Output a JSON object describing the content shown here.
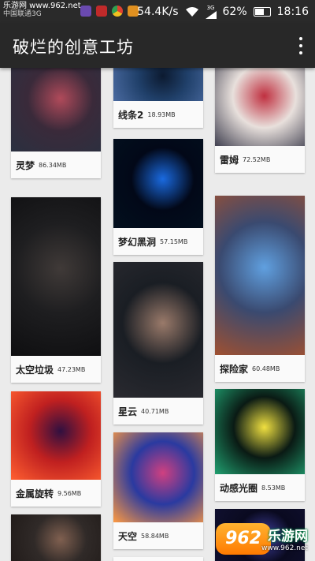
{
  "status_bar": {
    "watermark": "乐游网 www.962.net",
    "carrier": "中国联通3G",
    "speed": "54.4K/s",
    "network": "3G",
    "battery": "62%",
    "battery_level": 0.62,
    "time": "18:16"
  },
  "app_bar": {
    "title": "破烂的创意工坊"
  },
  "wallpapers": [
    {
      "name": "灵梦",
      "size": "86.34MB",
      "colors": [
        "#3a2a3a",
        "#b04a5a",
        "#2a3040"
      ]
    },
    {
      "name": "线条2",
      "size": "18.93MB",
      "colors": [
        "#20406a",
        "#0c1a30",
        "#4a6aa0"
      ]
    },
    {
      "name": "雷姆",
      "size": "72.52MB",
      "colors": [
        "#e8e0dc",
        "#c03040",
        "#404050"
      ]
    },
    {
      "name": "梦幻黑洞",
      "size": "57.15MB",
      "colors": [
        "#020818",
        "#1a6ae0",
        "#03101e"
      ]
    },
    {
      "name": "太空垃圾",
      "size": "47.23MB",
      "colors": [
        "#1e1e20",
        "#403a38",
        "#0e0e10"
      ]
    },
    {
      "name": "星云",
      "size": "40.71MB",
      "colors": [
        "#1a1e24",
        "#9a7a6a",
        "#2a2a30"
      ]
    },
    {
      "name": "探险家",
      "size": "60.48MB",
      "colors": [
        "#3a4a70",
        "#60a0e0",
        "#a05030"
      ]
    },
    {
      "name": "金属旋转",
      "size": "9.56MB",
      "colors": [
        "#c02020",
        "#301040",
        "#ff6030"
      ]
    },
    {
      "name": "天空",
      "size": "58.84MB",
      "colors": [
        "#2a3aa0",
        "#d04080",
        "#ff9a40"
      ]
    },
    {
      "name": "动感光圈",
      "size": "8.53MB",
      "colors": [
        "#0a1a14",
        "#f0e040",
        "#20a070"
      ]
    },
    {
      "name": "",
      "size": "",
      "colors": [
        "#302a28",
        "#806050",
        "#201a18"
      ]
    },
    {
      "name": "",
      "size": "",
      "colors": [
        "#0a0a20",
        "#4040a0",
        "#101030"
      ]
    }
  ],
  "watermark_bottom": {
    "logo": "962",
    "site": "乐游网",
    "url": "www.962.net"
  }
}
